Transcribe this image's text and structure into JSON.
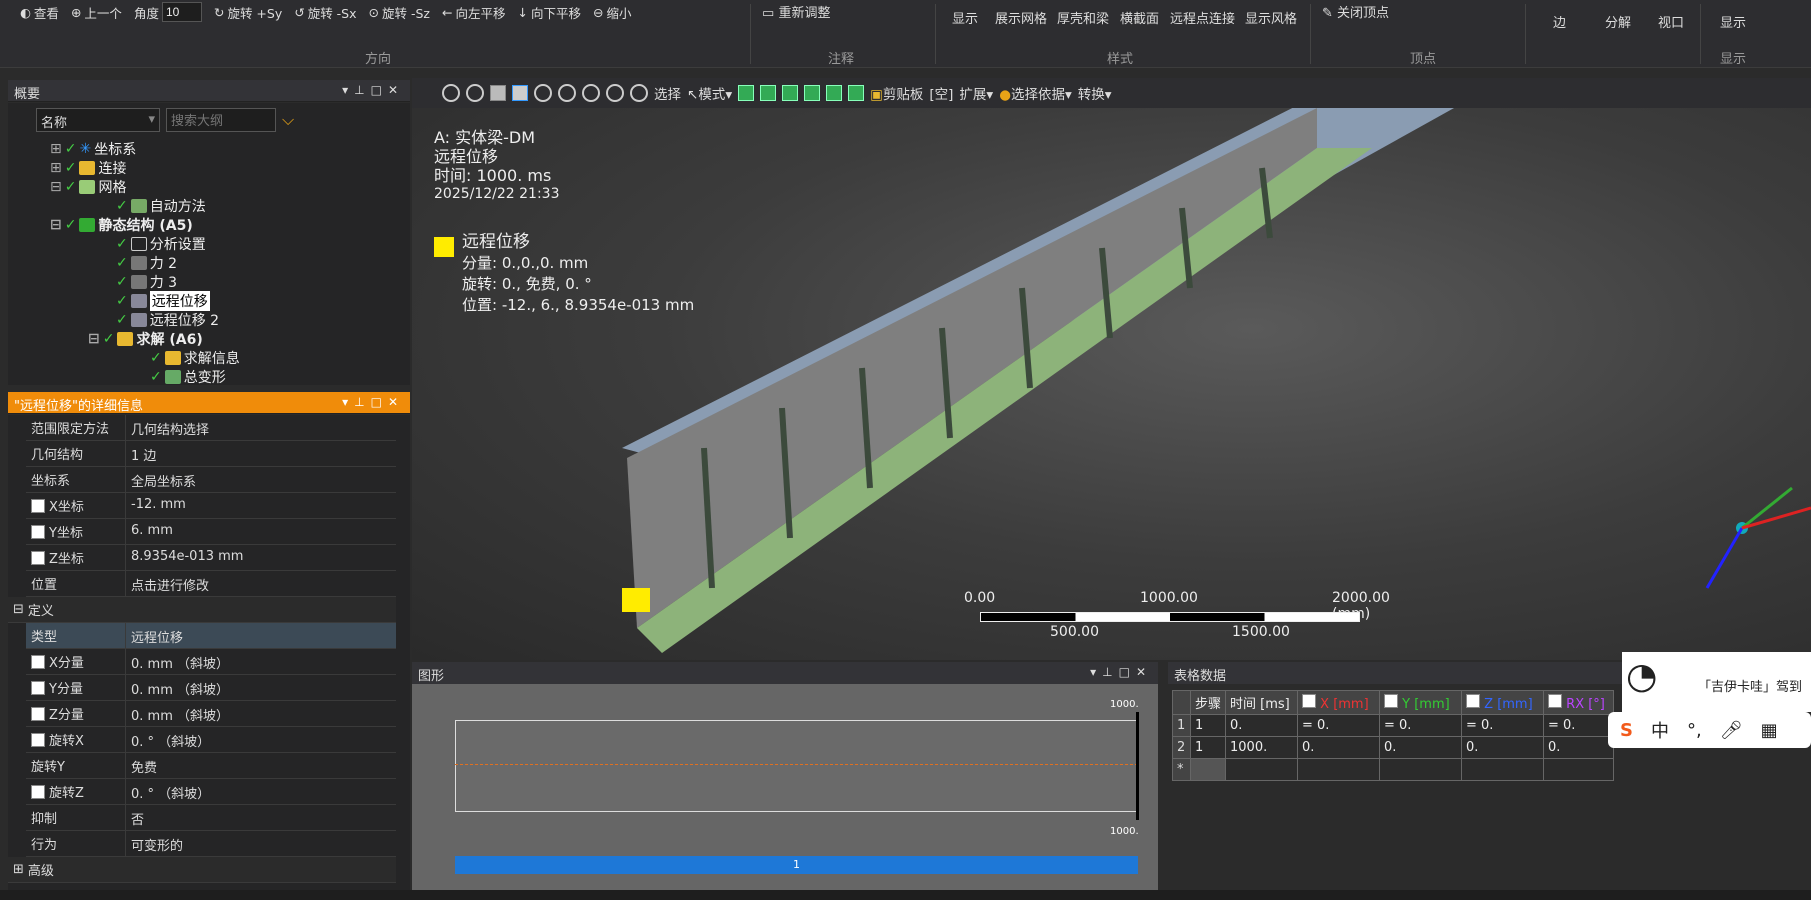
{
  "ribbon": {
    "view_btn": "查看",
    "prev_btn": "上一个",
    "angle_label": "角度",
    "angle_value": "10",
    "rot_sy": "旋转 +Sy",
    "rot_sx": "旋转 -Sx",
    "rot_sz": "旋转 -Sz",
    "pan_left": "向左平移",
    "pan_down": "向下平移",
    "zoom_out": "缩小",
    "readjust": "重新调整",
    "show": "显示",
    "show_mesh": "展示网格",
    "thick_shell": "厚壳和梁",
    "cross_section": "横截面",
    "remote_conn": "远程点连接",
    "show_style": "显示风格",
    "close_vertex": "关闭顶点",
    "edge": "边",
    "explode": "分解",
    "viewport": "视口",
    "display": "显示",
    "grp_direction": "方向",
    "grp_annotation": "注释",
    "grp_style": "样式",
    "grp_vertex": "顶点",
    "grp_display": "显示"
  },
  "outline": {
    "title": "概要",
    "col_name": "名称",
    "search_placeholder": "搜索大纲",
    "nodes": [
      "坐标系",
      "连接",
      "网格",
      "自动方法",
      "静态结构 (A5)",
      "分析设置",
      "力 2",
      "力 3",
      "远程位移",
      "远程位移 2",
      "求解 (A6)",
      "求解信息",
      "总变形"
    ]
  },
  "details": {
    "title": "\"远程位移\"的详细信息",
    "rows": [
      {
        "k": "范围限定方法",
        "v": "几何结构选择"
      },
      {
        "k": "几何结构",
        "v": "1 边"
      },
      {
        "k": "坐标系",
        "v": "全局坐标系"
      },
      {
        "k": "X坐标",
        "v": "-12. mm"
      },
      {
        "k": "Y坐标",
        "v": "6. mm"
      },
      {
        "k": "Z坐标",
        "v": "8.9354e-013 mm"
      },
      {
        "k": "位置",
        "v": "点击进行修改"
      },
      {
        "k": "定义",
        "v": ""
      },
      {
        "k": "类型",
        "v": "远程位移"
      },
      {
        "k": "X分量",
        "v": "0. mm （斜坡）"
      },
      {
        "k": "Y分量",
        "v": "0. mm （斜坡）"
      },
      {
        "k": "Z分量",
        "v": "0. mm （斜坡）"
      },
      {
        "k": "旋转X",
        "v": "0. ° （斜坡）"
      },
      {
        "k": "旋转Y",
        "v": "免费"
      },
      {
        "k": "旋转Z",
        "v": "0. ° （斜坡）"
      },
      {
        "k": "抑制",
        "v": "否"
      },
      {
        "k": "行为",
        "v": "可变形的"
      },
      {
        "k": "高级",
        "v": ""
      }
    ]
  },
  "viewport_toolbar": {
    "select": "选择",
    "mode": "模式",
    "clipboard": "剪贴板",
    "empty": "[空]",
    "expand": "扩展",
    "select_by": "选择依据",
    "convert": "转换"
  },
  "annotation": {
    "model": "A: 实体梁-DM",
    "result": "远程位移",
    "time": "时间: 1000. ms",
    "date": "2025/12/22 21:33",
    "legend_name": "远程位移",
    "components": "分量: 0.,0.,0. mm",
    "rotation": "旋转: 0., 免费, 0. °",
    "position": "位置: -12., 6., 8.9354e-013 mm"
  },
  "scale": {
    "t0": "0.00",
    "t1": "1000.00",
    "t2": "2000.00 (mm)",
    "b0": "500.00",
    "b1": "1500.00"
  },
  "graph": {
    "title": "图形",
    "ymax": "1000.",
    "ymin": "1000.",
    "step": "1"
  },
  "table": {
    "title": "表格数据",
    "headers": [
      "步骤",
      "时间 [ms]",
      "X [mm]",
      "Y [mm]",
      "Z [mm]",
      "RX [°]"
    ],
    "rows": [
      [
        "1",
        "1",
        "0.",
        "= 0.",
        "= 0.",
        "= 0.",
        "= 0."
      ],
      [
        "2",
        "1",
        "1000.",
        "0.",
        "0.",
        "0.",
        "0."
      ]
    ]
  },
  "popup": {
    "text": "「吉伊卡哇」驾到"
  },
  "ime": {
    "lang": "中"
  },
  "colors": {
    "accent_orange": "#f08c0a",
    "legend_yellow": "#ffec00",
    "beam_flange": "#8a9cb2",
    "beam_bottom": "#8db37a",
    "progress_blue": "#1e78d7"
  }
}
